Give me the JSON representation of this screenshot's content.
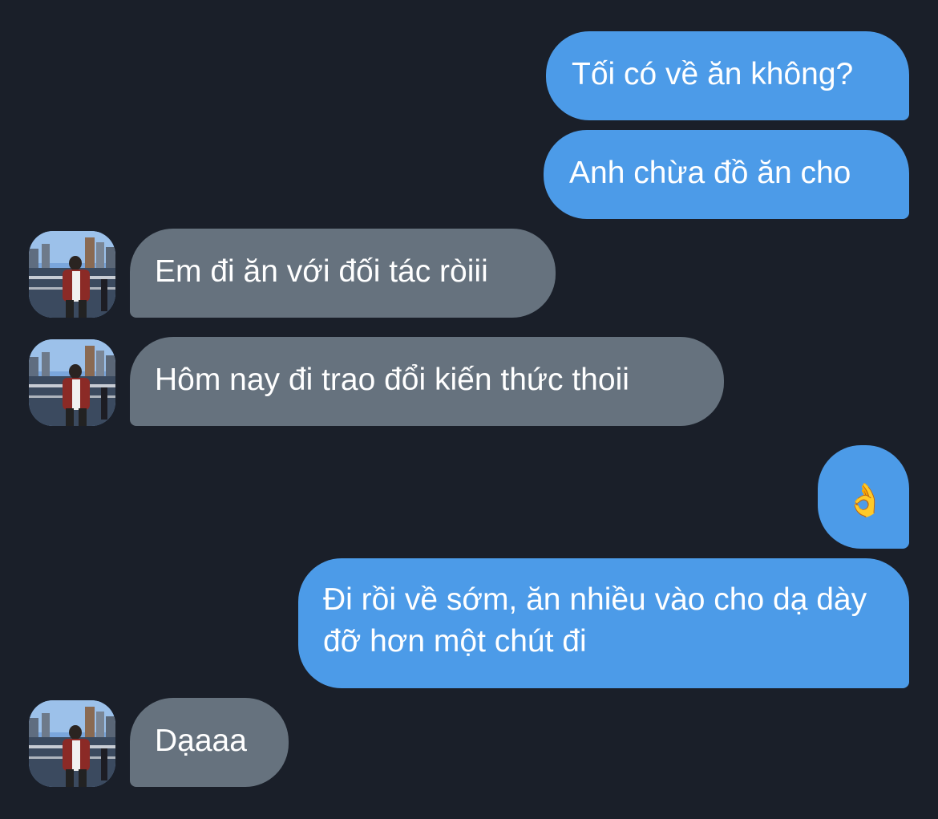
{
  "messages": [
    {
      "direction": "outgoing",
      "text": "Tối có về ăn không?"
    },
    {
      "direction": "outgoing",
      "text": "Anh chừa đồ ăn cho"
    },
    {
      "direction": "incoming",
      "text": "Em đi ăn với đối tác ròiii"
    },
    {
      "direction": "incoming",
      "text": "Hôm nay đi trao đổi kiến thức thoii"
    },
    {
      "direction": "outgoing",
      "text": "👌"
    },
    {
      "direction": "outgoing",
      "text": "Đi rồi về sớm, ăn nhiều vào cho dạ dày đỡ hơn một chút đi"
    },
    {
      "direction": "incoming",
      "text": "Dạaaa"
    }
  ],
  "colors": {
    "background": "#1a1f29",
    "outgoing_bubble": "#4c9be8",
    "incoming_bubble": "#66727e",
    "text": "#ffffff"
  }
}
